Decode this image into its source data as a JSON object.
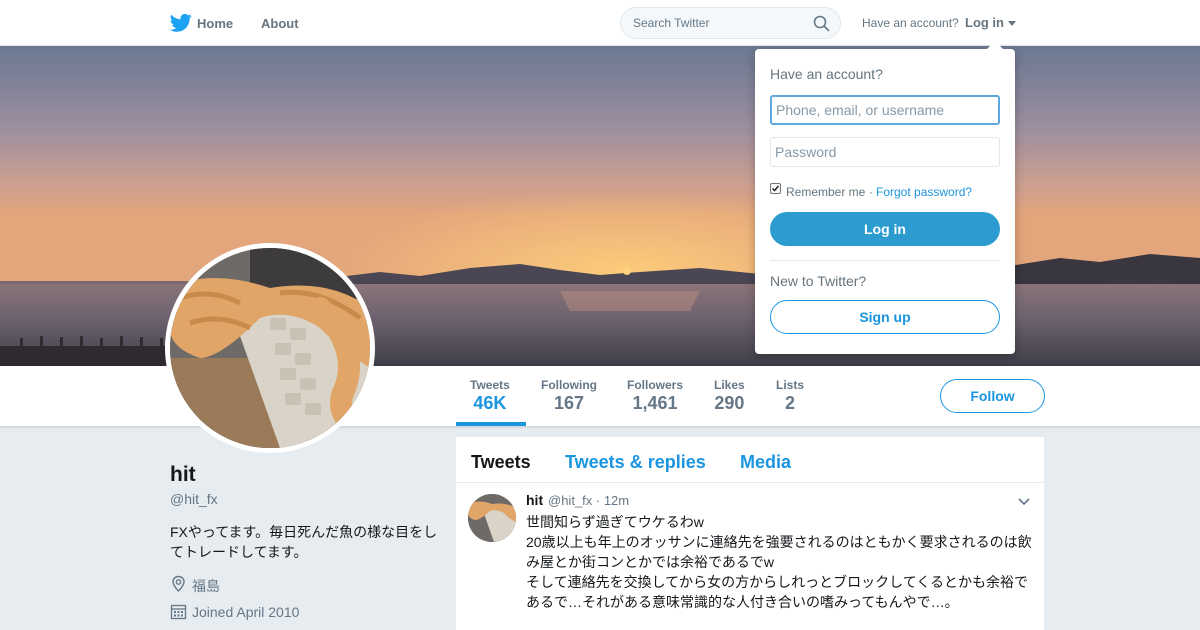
{
  "nav": {
    "home": "Home",
    "about": "About",
    "search_placeholder": "Search Twitter",
    "have_account": "Have an account?",
    "login": "Log in",
    "icons": [
      "twitter-bird-icon",
      "search-icon",
      "caret-down-icon"
    ]
  },
  "colors": {
    "accent": "#1b95e0",
    "login_button": "#2b9bd0",
    "background": "#e6ecf0"
  },
  "profile": {
    "name": "hit",
    "handle": "@hit_fx",
    "bio": "FXやってます。毎日死んだ魚の様な目をしてトレードしてます。",
    "location": "福島",
    "joined": "Joined April 2010"
  },
  "stats": [
    {
      "label": "Tweets",
      "value": "46K"
    },
    {
      "label": "Following",
      "value": "167"
    },
    {
      "label": "Followers",
      "value": "1,461"
    },
    {
      "label": "Likes",
      "value": "290"
    },
    {
      "label": "Lists",
      "value": "2"
    }
  ],
  "follow_label": "Follow",
  "tabs": [
    "Tweets",
    "Tweets & replies",
    "Media"
  ],
  "tweet": {
    "name": "hit",
    "meta": "@hit_fx · 12m",
    "text": "世間知らず過ぎてウケるわw\n20歳以上も年上のオッサンに連絡先を強要されるのはともかく要求されるのは飲み屋とか街コンとかでは余裕であるでw\nそして連絡先を交換してから女の方からしれっとブロックしてくるとかも余裕であるで…それがある意味常識的な人付き合いの嗜みってもんやで…。"
  },
  "login_dropdown": {
    "title": "Have an account?",
    "username_placeholder": "Phone, email, or username",
    "password_placeholder": "Password",
    "remember_checked": true,
    "remember": "Remember me",
    "separator": "·",
    "forgot": "Forgot password?",
    "login_button": "Log in",
    "new_to": "New to Twitter?",
    "signup_button": "Sign up"
  }
}
